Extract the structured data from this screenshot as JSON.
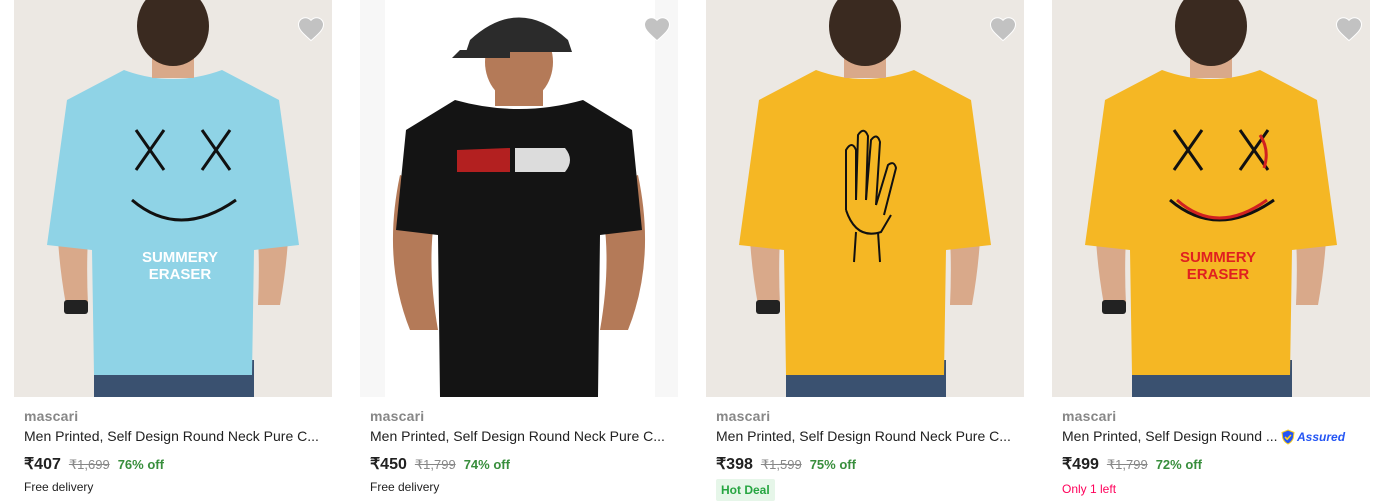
{
  "products": [
    {
      "brand": "mascari",
      "title": "Men Printed, Self Design Round Neck Pure C...",
      "price": "₹407",
      "mrp": "₹1,699",
      "discount": "76% off",
      "tag": "Free delivery",
      "shirt_color": "#8fd3e6",
      "bg_color": "#ece8e3",
      "print_text": [
        "SUMMERY",
        "ERASER"
      ]
    },
    {
      "brand": "mascari",
      "title": "Men Printed, Self Design Round Neck Pure C...",
      "price": "₹450",
      "mrp": "₹1,799",
      "discount": "74% off",
      "tag": "Free delivery",
      "shirt_color": "#141414",
      "bg_color": "#f7f7f7"
    },
    {
      "brand": "mascari",
      "title": "Men Printed, Self Design Round Neck Pure C...",
      "price": "₹398",
      "mrp": "₹1,599",
      "discount": "75% off",
      "tag": "Hot Deal",
      "shirt_color": "#f5b724",
      "bg_color": "#ece8e3"
    },
    {
      "brand": "mascari",
      "title": "Men Printed, Self Design Round ...",
      "price": "₹499",
      "mrp": "₹1,799",
      "discount": "72% off",
      "tag": "Only 1 left",
      "assured": "Assured",
      "shirt_color": "#f5b724",
      "bg_color": "#ece8e3",
      "print_text": [
        "SUMMERY",
        "ERASER"
      ]
    }
  ],
  "icons": {
    "wishlist": "heart-icon",
    "assured": "shield-check-icon"
  },
  "colors": {
    "discount_green": "#388e3c",
    "hot_deal_green": "#26a541",
    "only_left_pink": "#ff005a",
    "assured_blue": "#2455f4"
  }
}
